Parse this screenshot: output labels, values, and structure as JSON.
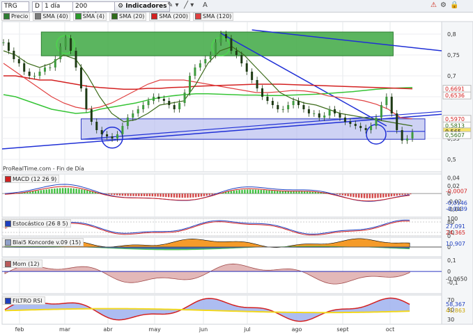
{
  "toolbar": {
    "symbol": "TRG",
    "mode_badge": "D",
    "timeframe": "1 día",
    "units": "200 unidades",
    "indicators_button": "Indicadores"
  },
  "legend": [
    {
      "label": "Precio",
      "color": "#2e7d32"
    },
    {
      "label": "SMA (40)",
      "color": "#7a7a7a"
    },
    {
      "label": "SMA (4)",
      "color": "#2b9a2b"
    },
    {
      "label": "SMA (20)",
      "color": "#2f6b1a"
    },
    {
      "label": "SMA (200)",
      "color": "#d32020"
    },
    {
      "label": "SMA (120)",
      "color": "#e04040"
    }
  ],
  "credit": "ProRealTime.com - Fin de Día",
  "panels": {
    "macd": {
      "label": "MACD (12 26 9)"
    },
    "stoch": {
      "label": "Estocástico (26 8 5)"
    },
    "koncorde": {
      "label": "Blai5 Koncorde v.09 (15)"
    },
    "mom": {
      "label": "Mom (12)"
    },
    "rsi": {
      "label": "FILTRO RSI"
    }
  },
  "chart_data": [
    {
      "type": "line",
      "name": "price",
      "x_labels": [
        "feb",
        "mar",
        "abr",
        "may",
        "jun",
        "jul",
        "ago",
        "sept",
        "oct"
      ],
      "ylim": [
        0.47,
        0.83
      ],
      "y_ticks": [
        "0,8",
        "0,75",
        "0,7",
        "0,65",
        "0,6",
        "0,55",
        "0,5"
      ],
      "price_tags": [
        {
          "text": "0,6691",
          "value": 0.669,
          "color": "#d32020",
          "bg": "#ffffff"
        },
        {
          "text": "0,6536",
          "value": 0.653,
          "color": "#d32020",
          "bg": "#ffffff"
        },
        {
          "text": "0,5970",
          "value": 0.597,
          "color": "#d32020",
          "bg": "#ffffff"
        },
        {
          "text": "0,5813",
          "value": 0.581,
          "color": "#2f6b1a",
          "bg": "#ffffff"
        },
        {
          "text": "0,565",
          "value": 0.567,
          "color": "#000000",
          "bg": "#f6e46a"
        },
        {
          "text": "0,5607",
          "value": 0.558,
          "color": "#2f6b1a",
          "bg": "#ffffff"
        }
      ],
      "close": [
        0.78,
        0.76,
        0.74,
        0.73,
        0.71,
        0.7,
        0.7,
        0.71,
        0.72,
        0.72,
        0.74,
        0.77,
        0.79,
        0.76,
        0.72,
        0.67,
        0.62,
        0.59,
        0.57,
        0.56,
        0.555,
        0.55,
        0.56,
        0.58,
        0.6,
        0.61,
        0.62,
        0.63,
        0.64,
        0.65,
        0.645,
        0.64,
        0.63,
        0.62,
        0.635,
        0.66,
        0.7,
        0.72,
        0.73,
        0.74,
        0.75,
        0.78,
        0.8,
        0.79,
        0.76,
        0.75,
        0.73,
        0.71,
        0.69,
        0.67,
        0.65,
        0.64,
        0.63,
        0.62,
        0.62,
        0.63,
        0.64,
        0.63,
        0.62,
        0.61,
        0.61,
        0.6,
        0.605,
        0.62,
        0.61,
        0.6,
        0.59,
        0.585,
        0.58,
        0.575,
        0.57,
        0.58,
        0.6,
        0.63,
        0.65,
        0.61,
        0.57,
        0.545,
        0.55,
        0.565
      ],
      "sma_red": [
        0.7,
        0.7,
        0.695,
        0.69,
        0.69,
        0.685,
        0.68,
        0.675,
        0.672,
        0.67,
        0.668,
        0.668,
        0.67,
        0.67,
        0.672,
        0.673,
        0.675,
        0.676,
        0.677,
        0.678,
        0.679,
        0.68,
        0.68,
        0.68,
        0.679,
        0.678,
        0.677,
        0.676,
        0.675,
        0.674,
        0.673,
        0.672,
        0.671,
        0.67,
        0.669
      ],
      "sma_red2": [
        0.73,
        0.71,
        0.69,
        0.67,
        0.65,
        0.635,
        0.625,
        0.62,
        0.625,
        0.635,
        0.65,
        0.665,
        0.68,
        0.69,
        0.69,
        0.69,
        0.685,
        0.68,
        0.675,
        0.67,
        0.665,
        0.66,
        0.66,
        0.662,
        0.665,
        0.664,
        0.66,
        0.652,
        0.648,
        0.645,
        0.64,
        0.632,
        0.62,
        0.6,
        0.597
      ],
      "sma_green": [
        0.655,
        0.65,
        0.64,
        0.63,
        0.62,
        0.615,
        0.61,
        0.612,
        0.62,
        0.625,
        0.63,
        0.635,
        0.642,
        0.648,
        0.652,
        0.655,
        0.657,
        0.657,
        0.656,
        0.655,
        0.654,
        0.654,
        0.653,
        0.653,
        0.654,
        0.655,
        0.656,
        0.658,
        0.66,
        0.662,
        0.665,
        0.668,
        0.67,
        0.671,
        0.672
      ],
      "sma_dark": [
        0.76,
        0.75,
        0.73,
        0.72,
        0.73,
        0.75,
        0.74,
        0.7,
        0.65,
        0.61,
        0.59,
        0.595,
        0.61,
        0.63,
        0.635,
        0.64,
        0.68,
        0.73,
        0.76,
        0.77,
        0.75,
        0.72,
        0.69,
        0.66,
        0.645,
        0.635,
        0.63,
        0.62,
        0.61,
        0.605,
        0.6,
        0.595,
        0.59,
        0.585,
        0.58
      ]
    },
    {
      "type": "bar",
      "name": "macd",
      "ylim": [
        -0.06,
        0.05
      ],
      "y_ticks": [
        "0,04",
        "0,02",
        "0",
        "-0,02",
        "-0,04"
      ],
      "value_tags": [
        {
          "text": "-0,0007",
          "value": -0.0007,
          "color": "#d32020"
        },
        {
          "text": "-0,0146",
          "value": -0.0146,
          "color": "#1f3fbf"
        },
        {
          "text": "-0,0139",
          "value": -0.0139,
          "color": "#1f3fbf"
        }
      ]
    },
    {
      "type": "line",
      "name": "stochastic",
      "ylim": [
        0,
        100
      ],
      "y_ticks": [
        "100",
        "80",
        "20",
        "0"
      ],
      "value_tags": [
        {
          "text": "27,091",
          "value": 27,
          "color": "#1f3fbf"
        },
        {
          "text": "24,365",
          "value": 24,
          "color": "#d32020"
        }
      ]
    },
    {
      "type": "area",
      "name": "koncorde",
      "ylim": [
        -30,
        30
      ],
      "y_ticks": [
        "0"
      ],
      "value_tags": [
        {
          "text": "10,907",
          "value": 10.9,
          "color": "#1f3fbf"
        }
      ]
    },
    {
      "type": "area",
      "name": "momentum",
      "ylim": [
        -0.2,
        0.12
      ],
      "y_ticks": [
        "0,1",
        "0",
        "-0,1"
      ],
      "value_tags": [
        {
          "text": "-0,0650",
          "value": -0.065,
          "color": "#333333"
        }
      ]
    },
    {
      "type": "area",
      "name": "rsi",
      "ylim": [
        20,
        80
      ],
      "y_ticks": [
        "70",
        "50",
        "30"
      ],
      "value_tags": [
        {
          "text": "58,367",
          "value": 58.4,
          "color": "#1f3fbf"
        },
        {
          "text": "41,863",
          "value": 41.9,
          "color": "#c9a400"
        }
      ]
    }
  ]
}
